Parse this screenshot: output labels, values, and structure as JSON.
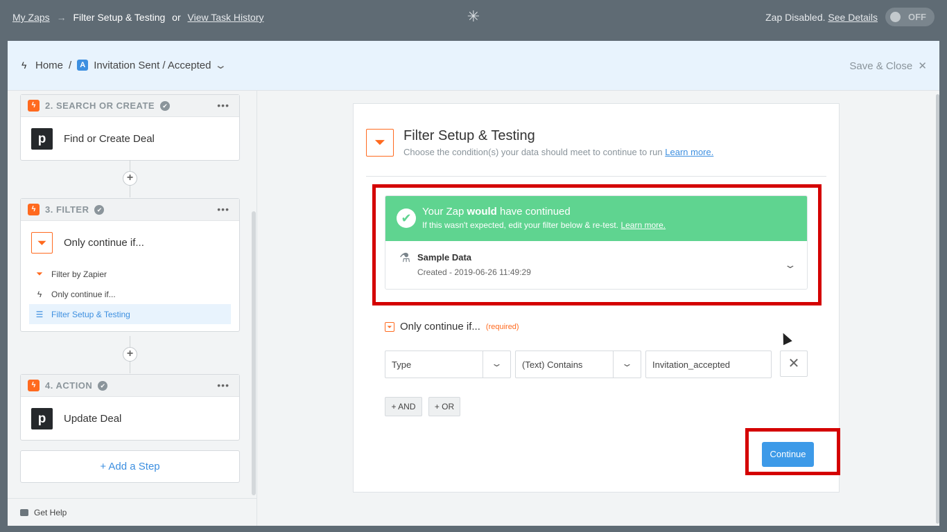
{
  "topbar": {
    "my_zaps": "My Zaps",
    "arrow": "→",
    "current": "Filter Setup & Testing",
    "or": "or",
    "task_history": "View Task History",
    "status_text": "Zap Disabled.",
    "see_details": "See Details",
    "toggle_label": "OFF"
  },
  "subheader": {
    "home": "Home",
    "slash": "/",
    "app_letter": "A",
    "zap_name": "Invitation Sent / Accepted",
    "save_close": "Save & Close"
  },
  "sidebar": {
    "steps": [
      {
        "number_label": "2. SEARCH OR CREATE",
        "app_letter": "p",
        "title": "Find or Create Deal"
      },
      {
        "number_label": "3. FILTER",
        "title": "Only continue if..."
      },
      {
        "number_label": "4. ACTION",
        "app_letter": "p",
        "title": "Update Deal"
      }
    ],
    "filter_subitems": [
      {
        "label": "Filter by Zapier"
      },
      {
        "label": "Only continue if..."
      },
      {
        "label": "Filter Setup & Testing"
      }
    ],
    "add_step": "+ Add a Step",
    "get_help": "Get Help"
  },
  "panel": {
    "title": "Filter Setup & Testing",
    "description": "Choose the condition(s) your data should meet to continue to run",
    "learn_more": "Learn more.",
    "result": {
      "line1_pre": "Your Zap ",
      "line1_bold": "would",
      "line1_post": " have continued",
      "line2": "If this wasn't expected, edit your filter below & re-test.",
      "line2_link": "Learn more."
    },
    "sample": {
      "title": "Sample Data",
      "created": "Created - 2019-06-26 11:49:29"
    },
    "condition": {
      "label": "Only continue if...",
      "required": "(required)",
      "field": "Type",
      "operator": "(Text) Contains",
      "value": "Invitation_accepted"
    },
    "and_label": "+ AND",
    "or_label": "+ OR",
    "continue_label": "Continue"
  },
  "colors": {
    "brand_orange": "#ff6a1f",
    "success_green": "#5fd490",
    "primary_blue": "#3d9ae8",
    "highlight_red": "#d40000"
  }
}
